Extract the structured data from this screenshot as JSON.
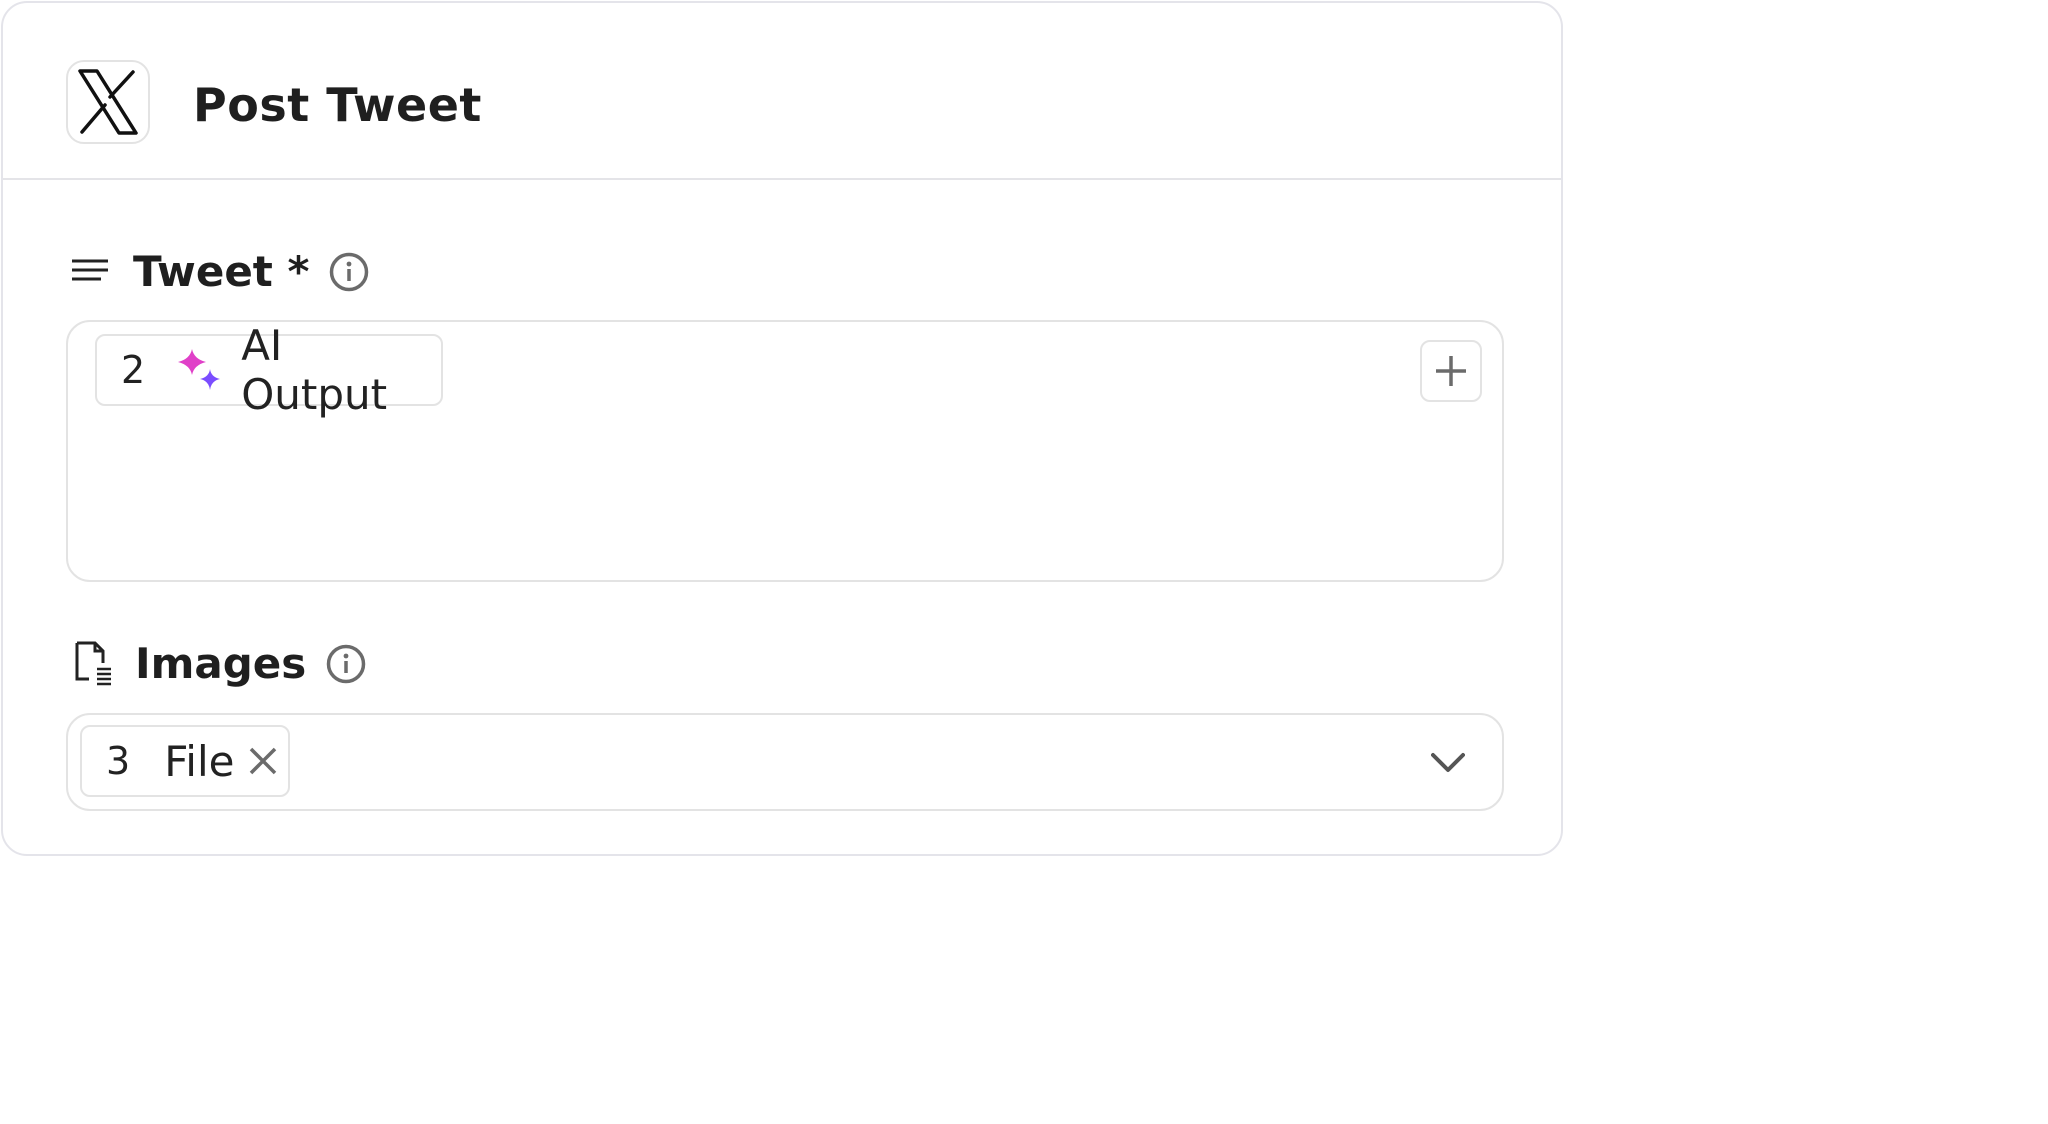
{
  "header": {
    "title": "Post Tweet",
    "app_icon": "x-logo-icon"
  },
  "fields": {
    "tweet": {
      "label": "Tweet *",
      "icon": "text-lines-icon",
      "info_icon": "info-icon",
      "chip": {
        "index": "2",
        "icon": "sparkles-icon",
        "label": "AI Output"
      },
      "add_icon": "plus-icon"
    },
    "images": {
      "label": "Images",
      "icon": "file-icon",
      "info_icon": "info-icon",
      "chip": {
        "index": "3",
        "label": "File",
        "remove_icon": "close-icon"
      },
      "dropdown_icon": "chevron-down-icon"
    }
  },
  "colors": {
    "border": "#e3e3e3",
    "text": "#1f1f1f",
    "muted_icon": "#6b6b6b",
    "sparkle_pink": "#e040c8",
    "sparkle_purple": "#7b4dff"
  }
}
